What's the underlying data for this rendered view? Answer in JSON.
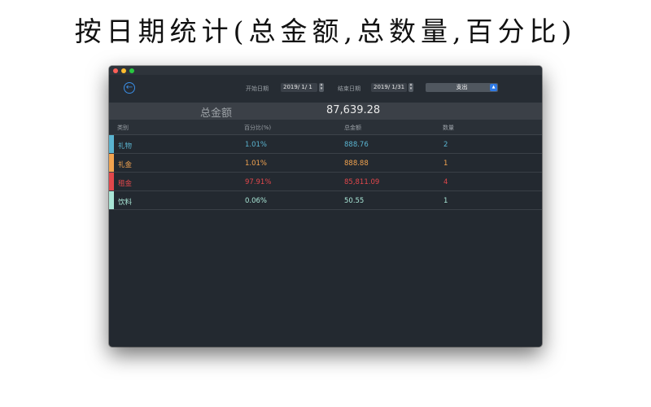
{
  "headline": "按日期统计(总金额,总数量,百分比)",
  "toolbar": {
    "start_label": "开始日期",
    "start_date": "2019/ 1/ 1",
    "end_label": "结束日期",
    "end_date": "2019/ 1/31",
    "type_selected": "支出"
  },
  "summary": {
    "total_label": "总金额",
    "total_value": "87,639.28"
  },
  "table": {
    "columns": [
      "类别",
      "百分比(%)",
      "总金额",
      "数量"
    ],
    "rows": [
      {
        "category": "礼物",
        "percent": "1.01%",
        "amount": "888.76",
        "count": "2",
        "color": "#5ab4d0"
      },
      {
        "category": "礼金",
        "percent": "1.01%",
        "amount": "888.88",
        "count": "1",
        "color": "#f2a34f"
      },
      {
        "category": "租金",
        "percent": "97.91%",
        "amount": "85,811.09",
        "count": "4",
        "color": "#e2474b"
      },
      {
        "category": "饮料",
        "percent": "0.06%",
        "amount": "50.55",
        "count": "1",
        "color": "#a9e6d6"
      }
    ]
  }
}
